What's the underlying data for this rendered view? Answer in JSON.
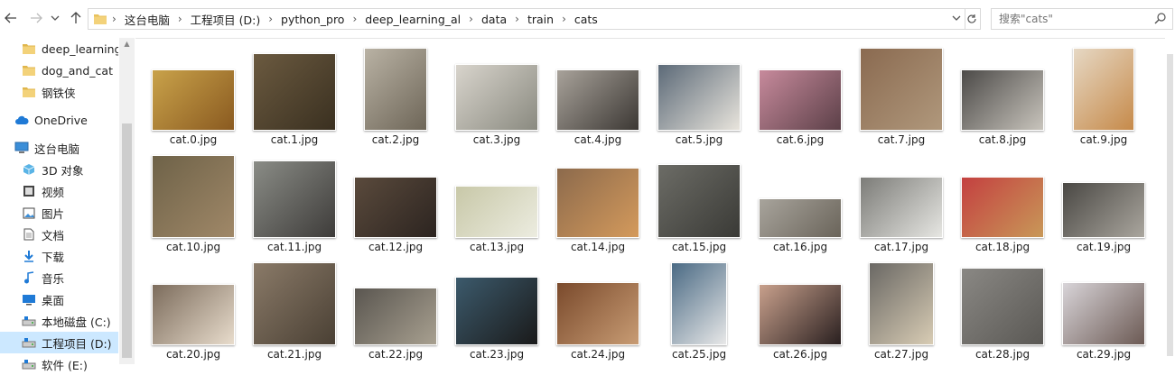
{
  "nav": {
    "back_icon": "arrow-left-icon",
    "forward_icon": "arrow-right-icon",
    "recent_icon": "chevron-down-icon",
    "up_icon": "arrow-up-icon"
  },
  "address": {
    "crumbs": [
      "这台电脑",
      "工程项目 (D:)",
      "python_pro",
      "deep_learning_al",
      "data",
      "train",
      "cats"
    ]
  },
  "search": {
    "placeholder": "搜索\"cats\""
  },
  "sidebar": {
    "items": [
      {
        "label": "deep_learning_",
        "icon": "folder-icon"
      },
      {
        "label": "dog_and_cat",
        "icon": "folder-icon"
      },
      {
        "label": "钢铁侠",
        "icon": "folder-icon"
      },
      {
        "label": "OneDrive",
        "icon": "cloud-icon"
      },
      {
        "label": "这台电脑",
        "icon": "computer-icon"
      },
      {
        "label": "3D 对象",
        "icon": "cube-icon"
      },
      {
        "label": "视频",
        "icon": "video-icon"
      },
      {
        "label": "图片",
        "icon": "picture-icon"
      },
      {
        "label": "文档",
        "icon": "document-icon"
      },
      {
        "label": "下载",
        "icon": "download-icon"
      },
      {
        "label": "音乐",
        "icon": "music-icon"
      },
      {
        "label": "桌面",
        "icon": "desktop-icon"
      },
      {
        "label": "本地磁盘 (C:)",
        "icon": "drive-icon"
      },
      {
        "label": "工程项目 (D:)",
        "icon": "drive-icon"
      },
      {
        "label": "软件 (E:)",
        "icon": "drive-icon"
      }
    ]
  },
  "files": [
    {
      "name": "cat.0.jpg",
      "colors": [
        "#c9a24a",
        "#8a5a20"
      ]
    },
    {
      "name": "cat.1.jpg",
      "colors": [
        "#6b5a40",
        "#3a3020"
      ]
    },
    {
      "name": "cat.2.jpg",
      "colors": [
        "#b9b2a4",
        "#6e6658"
      ]
    },
    {
      "name": "cat.3.jpg",
      "colors": [
        "#d8d4cc",
        "#8a8a80"
      ]
    },
    {
      "name": "cat.4.jpg",
      "colors": [
        "#a8a29a",
        "#3c3834"
      ]
    },
    {
      "name": "cat.5.jpg",
      "colors": [
        "#5c6a78",
        "#e8e4dc"
      ]
    },
    {
      "name": "cat.6.jpg",
      "colors": [
        "#c78a9c",
        "#5c4048"
      ]
    },
    {
      "name": "cat.7.jpg",
      "colors": [
        "#8a6a50",
        "#b0987c"
      ]
    },
    {
      "name": "cat.8.jpg",
      "colors": [
        "#4c4a48",
        "#c8c4bc"
      ]
    },
    {
      "name": "cat.9.jpg",
      "colors": [
        "#e6d8c4",
        "#c68a4a"
      ]
    },
    {
      "name": "cat.10.jpg",
      "colors": [
        "#6e6248",
        "#a08868"
      ]
    },
    {
      "name": "cat.11.jpg",
      "colors": [
        "#8a8c86",
        "#3e3c3a"
      ]
    },
    {
      "name": "cat.12.jpg",
      "colors": [
        "#5a4a3c",
        "#2c2420"
      ]
    },
    {
      "name": "cat.13.jpg",
      "colors": [
        "#c8c8a8",
        "#ecece0"
      ]
    },
    {
      "name": "cat.14.jpg",
      "colors": [
        "#8c6a4c",
        "#d49a5c"
      ]
    },
    {
      "name": "cat.15.jpg",
      "colors": [
        "#6c6c66",
        "#3a3a36"
      ]
    },
    {
      "name": "cat.16.jpg",
      "colors": [
        "#a8a49c",
        "#6a645a"
      ]
    },
    {
      "name": "cat.17.jpg",
      "colors": [
        "#7c7c78",
        "#e6e6e2"
      ]
    },
    {
      "name": "cat.18.jpg",
      "colors": [
        "#c44040",
        "#c89858"
      ]
    },
    {
      "name": "cat.19.jpg",
      "colors": [
        "#4a4844",
        "#aaa69e"
      ]
    },
    {
      "name": "cat.20.jpg",
      "colors": [
        "#7c6c5c",
        "#e8dccc"
      ]
    },
    {
      "name": "cat.21.jpg",
      "colors": [
        "#8a7a68",
        "#4a4034"
      ]
    },
    {
      "name": "cat.22.jpg",
      "colors": [
        "#5a5650",
        "#a8a090"
      ]
    },
    {
      "name": "cat.23.jpg",
      "colors": [
        "#3c5a6c",
        "#1a1a1a"
      ]
    },
    {
      "name": "cat.24.jpg",
      "colors": [
        "#7a4a2c",
        "#c89c74"
      ]
    },
    {
      "name": "cat.25.jpg",
      "colors": [
        "#4a6a84",
        "#e8e8e8"
      ]
    },
    {
      "name": "cat.26.jpg",
      "colors": [
        "#c8a08c",
        "#2a2020"
      ]
    },
    {
      "name": "cat.27.jpg",
      "colors": [
        "#6a6864",
        "#d8ccb4"
      ]
    },
    {
      "name": "cat.28.jpg",
      "colors": [
        "#8a8884",
        "#5a5854"
      ]
    },
    {
      "name": "cat.29.jpg",
      "colors": [
        "#d8d4d8",
        "#6c5a54"
      ]
    }
  ]
}
